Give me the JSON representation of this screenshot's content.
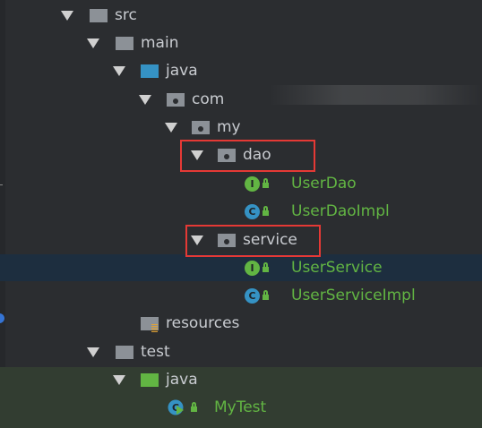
{
  "project_tree": {
    "items": [
      {
        "label": "src",
        "icon": "folder-icon"
      },
      {
        "label": "main",
        "icon": "folder-icon"
      },
      {
        "label": "java",
        "icon": "source-root-folder-icon"
      },
      {
        "label": "com",
        "icon": "package-icon"
      },
      {
        "label": "my",
        "icon": "package-icon"
      },
      {
        "label": "dao",
        "icon": "package-icon"
      },
      {
        "label": "UserDao",
        "icon": "interface-icon",
        "badge": "I"
      },
      {
        "label": "UserDaoImpl",
        "icon": "class-icon",
        "badge": "C"
      },
      {
        "label": "service",
        "icon": "package-icon"
      },
      {
        "label": "UserService",
        "icon": "interface-icon",
        "badge": "I"
      },
      {
        "label": "UserServiceImpl",
        "icon": "class-icon",
        "badge": "C"
      },
      {
        "label": "resources",
        "icon": "resources-folder-icon"
      },
      {
        "label": "test",
        "icon": "folder-icon"
      },
      {
        "label": "java",
        "icon": "test-source-root-folder-icon"
      },
      {
        "label": "MyTest",
        "icon": "test-class-icon",
        "badge": "C"
      }
    ],
    "selected_item": "UserService",
    "highlighted_items": [
      "dao",
      "service"
    ]
  },
  "colors": {
    "background": "#2b2d30",
    "selected_row": "#1d2e3f",
    "test_rows": "#323d31",
    "text": "#c9ccd1",
    "vcs_added_text": "#62b543",
    "highlight_box": "#e53935"
  }
}
